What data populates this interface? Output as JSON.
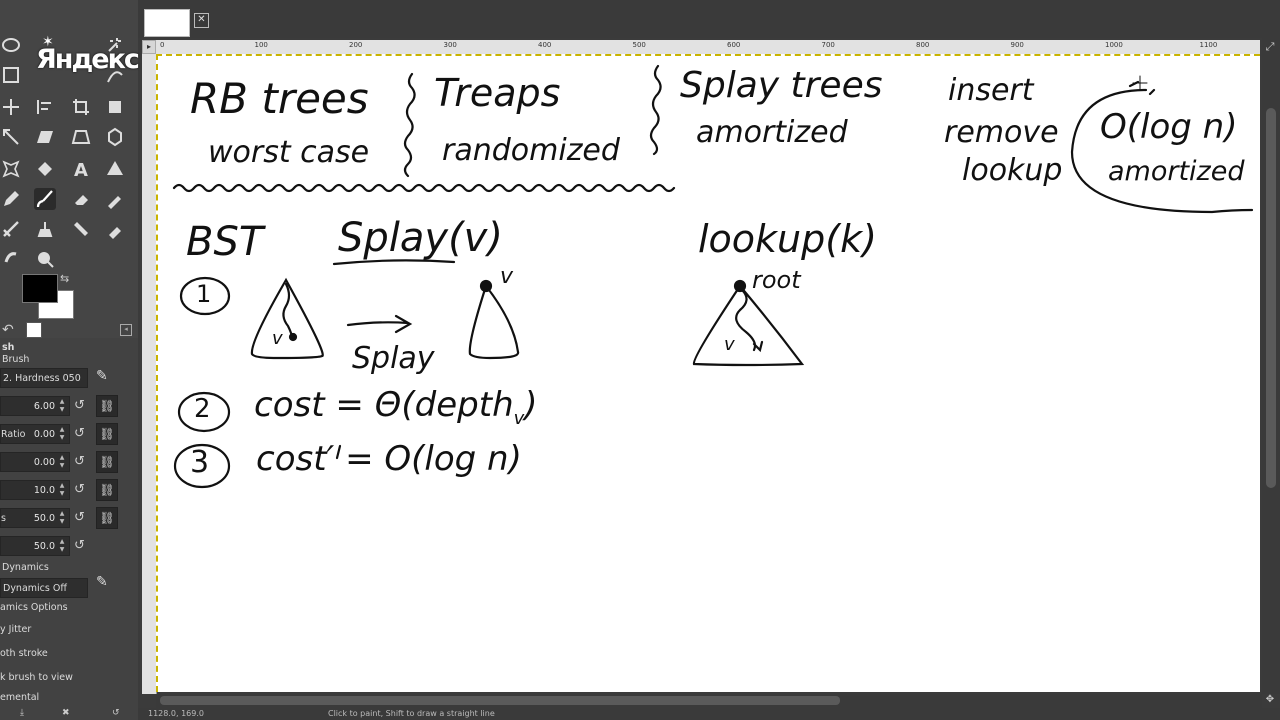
{
  "branding": {
    "logo_text": "Яндекс"
  },
  "tool_options": {
    "tool_title": "sh",
    "brush_label": "Brush",
    "brush_value": "2. Hardness 050",
    "size_value": "6.00",
    "ratio_label": "Ratio",
    "ratio_value": "0.00",
    "angle_value": "0.00",
    "spacing_value": "10.0",
    "hardness_label": "s",
    "hardness_value": "50.0",
    "force_value": "50.0",
    "dynamics_label": "Dynamics",
    "dynamics_value": "Dynamics Off",
    "dynamics_options": "amics Options",
    "jitter": "y Jitter",
    "smooth": "oth stroke",
    "lock_view": "k brush to view",
    "incremental": "emental"
  },
  "rulers": {
    "h_labels": [
      "0",
      "100",
      "200",
      "300",
      "400",
      "500",
      "600",
      "700",
      "800",
      "900",
      "1000",
      "1100"
    ]
  },
  "canvas_notes": {
    "rb_trees": "RB trees",
    "worst_case": "worst case",
    "treaps": "Treaps",
    "randomized": "randomized",
    "splay_trees": "Splay trees",
    "amortized_top": "amortized",
    "insert": "insert",
    "remove": "remove",
    "lookup_word": "lookup",
    "o_log_n": "O(log n)",
    "amortized_right": "amortized",
    "bst": "BST",
    "splay_v": "Splay(v)",
    "lookup_k": "lookup(k)",
    "root": "root",
    "step1": "1",
    "step2": "2",
    "step3": "3",
    "v_left": "v",
    "v_right": "v",
    "v_lookup": "v",
    "splay_arrow": "Splay",
    "cost_depth": "cost  =  Θ(depth",
    "depth_sub": "v",
    "depth_close": ")",
    "cost_log": "cost′  =  O(log n)"
  },
  "status": {
    "coords": "1128.0, 169.0",
    "message": "Click to paint, Shift to draw a straight line"
  }
}
